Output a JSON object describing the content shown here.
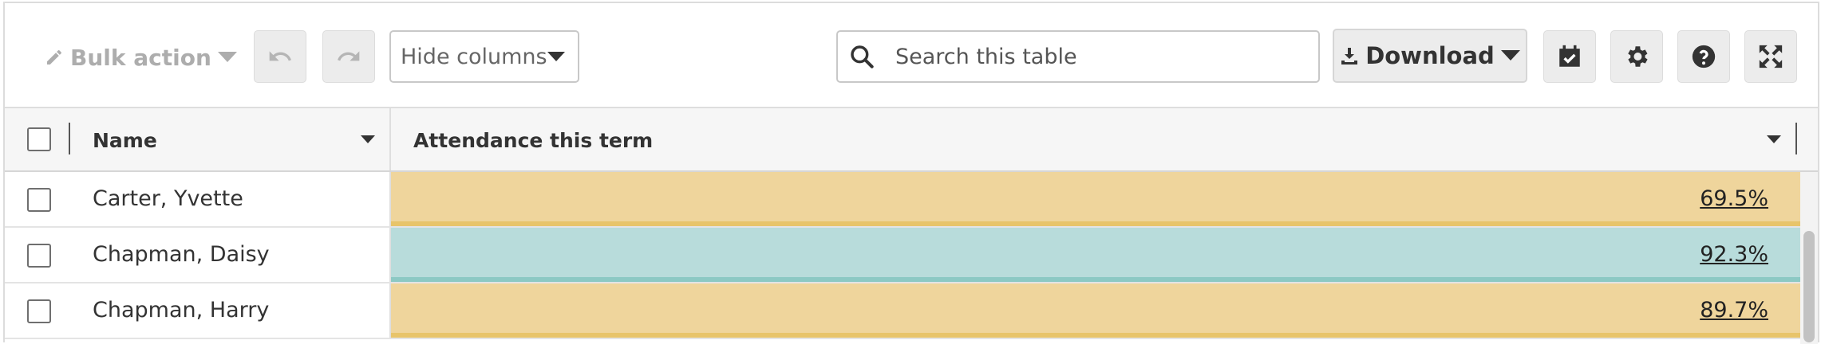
{
  "toolbar": {
    "bulk_action_label": "Bulk action",
    "hide_columns_label": "Hide columns",
    "search_placeholder": "Search this table",
    "download_label": "Download"
  },
  "table": {
    "columns": [
      {
        "label": "Name"
      },
      {
        "label": "Attendance this term"
      }
    ],
    "rows": [
      {
        "name": "Carter, Yvette",
        "attendance": "69.5%",
        "status": "amber"
      },
      {
        "name": "Chapman, Daisy",
        "attendance": "92.3%",
        "status": "green"
      },
      {
        "name": "Chapman, Harry",
        "attendance": "89.7%",
        "status": "amber"
      }
    ]
  },
  "colors": {
    "amber_fill": "#efd59c",
    "amber_bar": "#e8c46a",
    "green_fill": "#b8dcdb",
    "green_bar": "#8cc9c4"
  },
  "icons": [
    "pencil-icon",
    "caret-down-icon",
    "undo-icon",
    "redo-icon",
    "search-icon",
    "download-icon",
    "calendar-check-icon",
    "gear-icon",
    "help-icon",
    "fullscreen-icon"
  ]
}
